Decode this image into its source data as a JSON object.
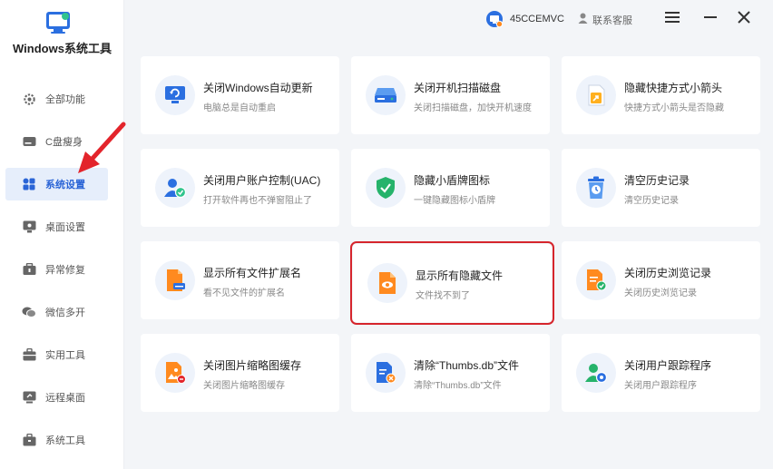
{
  "app": {
    "title": "Windows系统工具"
  },
  "sidebar": {
    "items": [
      {
        "label": "全部功能",
        "icon": "gear-icon"
      },
      {
        "label": "C盘瘦身",
        "icon": "disk-icon"
      },
      {
        "label": "系统设置",
        "icon": "grid-icon",
        "active": true
      },
      {
        "label": "桌面设置",
        "icon": "monitor-icon"
      },
      {
        "label": "异常修复",
        "icon": "wrench-icon"
      },
      {
        "label": "微信多开",
        "icon": "wechat-icon"
      },
      {
        "label": "实用工具",
        "icon": "toolbox-icon"
      },
      {
        "label": "远程桌面",
        "icon": "remote-desktop-icon"
      },
      {
        "label": "系统工具",
        "icon": "briefcase-icon"
      }
    ]
  },
  "header": {
    "username": "45CCEMVC",
    "support_label": "联系客服"
  },
  "cards": [
    {
      "title": "关闭Windows自动更新",
      "subtitle": "电脑总是自动重启",
      "icon": "refresh-screen-icon"
    },
    {
      "title": "关闭开机扫描磁盘",
      "subtitle": "关闭扫描磁盘，加快开机速度",
      "icon": "drive-icon"
    },
    {
      "title": "隐藏快捷方式小箭头",
      "subtitle": "快捷方式小箭头是否隐藏",
      "icon": "shortcut-arrow-icon"
    },
    {
      "title": "关闭用户账户控制(UAC)",
      "subtitle": "打开软件再也不弹窗阻止了",
      "icon": "user-shield-icon"
    },
    {
      "title": "隐藏小盾牌图标",
      "subtitle": "一键隐藏图标小盾牌",
      "icon": "shield-check-icon"
    },
    {
      "title": "清空历史记录",
      "subtitle": "清空历史记录",
      "icon": "trash-clock-icon"
    },
    {
      "title": "显示所有文件扩展名",
      "subtitle": "看不见文件的扩展名",
      "icon": "file-extension-icon"
    },
    {
      "title": "显示所有隐藏文件",
      "subtitle": "文件找不到了",
      "icon": "file-eye-icon",
      "highlighted": true
    },
    {
      "title": "关闭历史浏览记录",
      "subtitle": "关闭历史浏览记录",
      "icon": "file-check-icon"
    },
    {
      "title": "关闭图片缩略图缓存",
      "subtitle": "关闭图片缩略图缓存",
      "icon": "image-file-icon"
    },
    {
      "title": "清除“Thumbs.db”文件",
      "subtitle": "清除“Thumbs.db”文件",
      "icon": "file-delete-icon"
    },
    {
      "title": "关闭用户跟踪程序",
      "subtitle": "关闭用户跟踪程序",
      "icon": "user-settings-icon"
    }
  ],
  "colors": {
    "accent": "#2a64d6",
    "highlight": "#d6252c",
    "arrow": "#e3242b"
  }
}
